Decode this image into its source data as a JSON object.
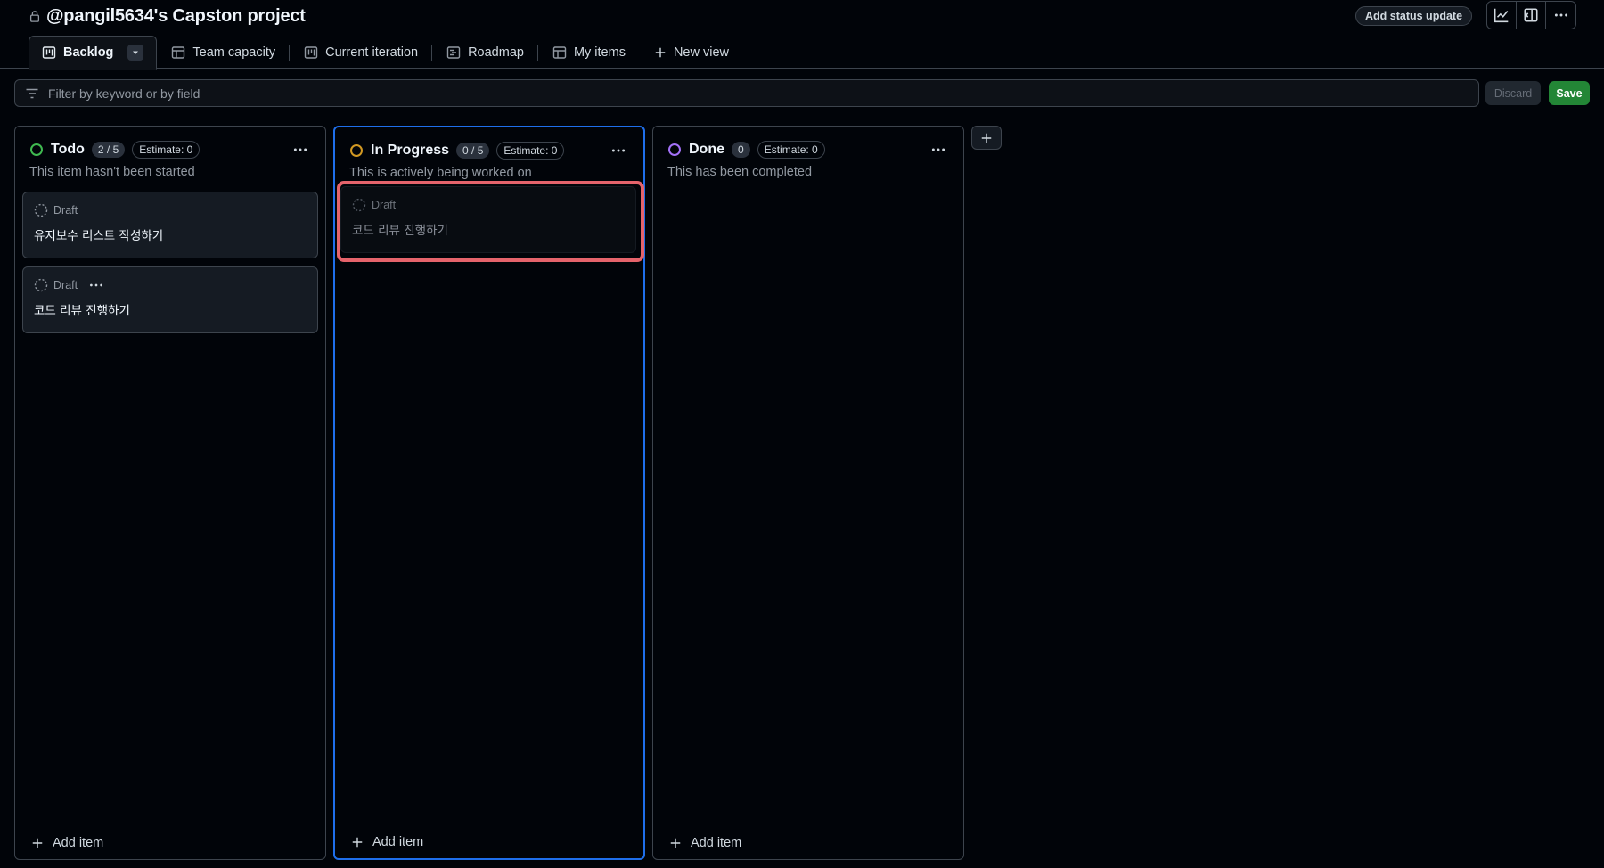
{
  "header": {
    "title": "@pangil5634's Capston project",
    "status_button": "Add status update"
  },
  "tabs": [
    {
      "label": "Backlog",
      "icon": "board-icon",
      "active": true
    },
    {
      "label": "Team capacity",
      "icon": "table-icon"
    },
    {
      "label": "Current iteration",
      "icon": "board-icon"
    },
    {
      "label": "Roadmap",
      "icon": "roadmap-icon"
    },
    {
      "label": "My items",
      "icon": "table-icon"
    },
    {
      "label": "New view",
      "icon": "plus-icon"
    }
  ],
  "filter": {
    "placeholder": "Filter by keyword or by field",
    "discard_label": "Discard",
    "save_label": "Save"
  },
  "columns": [
    {
      "title": "Todo",
      "count": "2 / 5",
      "estimate": "Estimate: 0",
      "description": "This item hasn't been started",
      "status_color": "#3fb950",
      "add_item": "Add item",
      "cards": [
        {
          "status": "Draft",
          "title": "유지보수 리스트 작성하기"
        },
        {
          "status": "Draft",
          "title": "코드 리뷰 진행하기"
        }
      ]
    },
    {
      "title": "In Progress",
      "count": "0 / 5",
      "estimate": "Estimate: 0",
      "description": "This is actively being worked on",
      "status_color": "#d29922",
      "add_item": "Add item",
      "cards": [
        {
          "status": "Draft",
          "title": "코드 리뷰 진행하기"
        }
      ]
    },
    {
      "title": "Done",
      "count": "0",
      "estimate": "Estimate: 0",
      "description": "This has been completed",
      "status_color": "#a371f7",
      "add_item": "Add item",
      "cards": []
    }
  ],
  "colors": {
    "accent": "#1f6feb",
    "save_green": "#238636",
    "highlight": "#e5636b"
  }
}
